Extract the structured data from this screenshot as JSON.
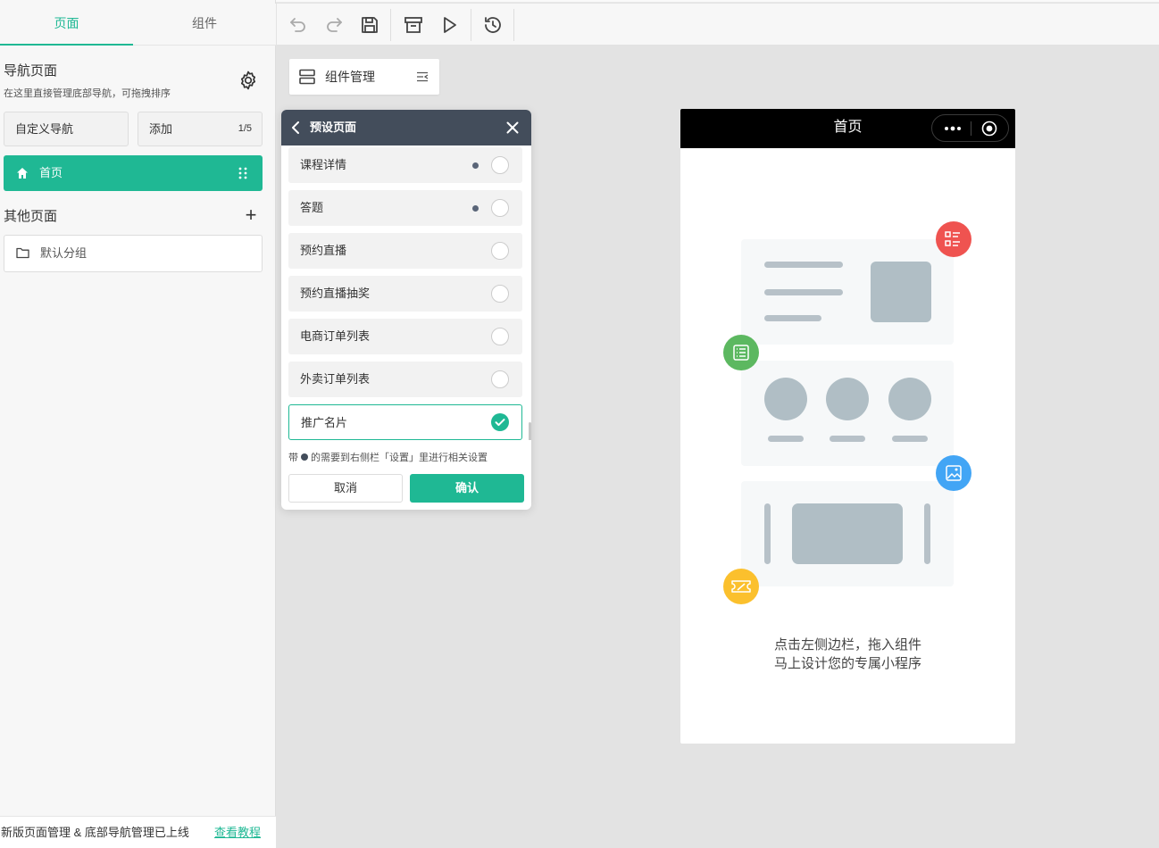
{
  "left_panel": {
    "tabs": [
      {
        "label": "页面"
      },
      {
        "label": "组件"
      }
    ],
    "nav_section": {
      "title": "导航页面",
      "description": "在这里直接管理底部导航，可拖拽排序",
      "custom_nav_label": "自定义导航",
      "add_label": "添加",
      "add_count": "1/5"
    },
    "home_item": {
      "label": "首页"
    },
    "other_section": {
      "title": "其他页面",
      "group_label": "默认分组"
    },
    "footer": {
      "text": "新版页面管理 & 底部导航管理已上线",
      "link": "查看教程"
    }
  },
  "toolbar": {
    "icons": [
      "undo-icon",
      "redo-icon",
      "save-icon",
      "archive-icon",
      "play-icon",
      "history-icon"
    ]
  },
  "component_manager": {
    "label": "组件管理"
  },
  "dialog": {
    "title": "预设页面",
    "options": [
      {
        "label": "课程详情",
        "needs_setting": true,
        "selected": false
      },
      {
        "label": "答题",
        "needs_setting": true,
        "selected": false
      },
      {
        "label": "预约直播",
        "needs_setting": false,
        "selected": false
      },
      {
        "label": "预约直播抽奖",
        "needs_setting": false,
        "selected": false
      },
      {
        "label": "电商订单列表",
        "needs_setting": false,
        "selected": false
      },
      {
        "label": "外卖订单列表",
        "needs_setting": false,
        "selected": false
      },
      {
        "label": "推广名片",
        "needs_setting": false,
        "selected": true
      }
    ],
    "note_prefix": "带",
    "note_suffix": "的需要到右侧栏「设置」里进行相关设置",
    "cancel_label": "取消",
    "confirm_label": "确认"
  },
  "phone": {
    "title": "首页",
    "empty_line1": "点击左侧边栏，拖入组件",
    "empty_line2": "马上设计您的专属小程序"
  },
  "colors": {
    "accent": "#1fb894",
    "dialog_header": "#434d5b",
    "badge_red": "#ef5350",
    "badge_green": "#5cb860",
    "badge_blue": "#42a5f5",
    "badge_yellow": "#fbc02d"
  }
}
